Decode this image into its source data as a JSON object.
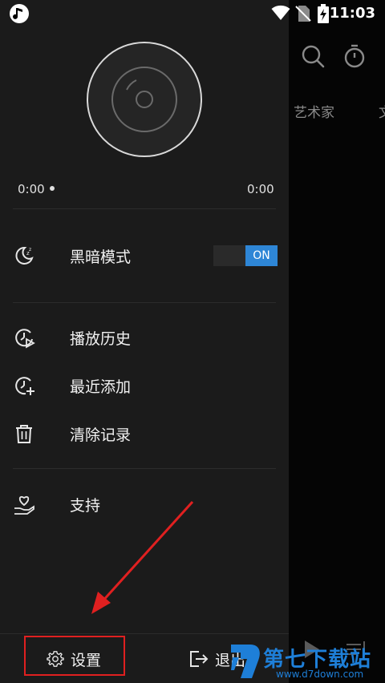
{
  "status_bar": {
    "time": "11:03"
  },
  "background": {
    "tabs": [
      {
        "label": "艺术家"
      },
      {
        "label": "文"
      }
    ]
  },
  "player": {
    "current_time": "0:00",
    "total_time": "0:00",
    "progress": 0
  },
  "menu": {
    "dark_mode": {
      "label": "黑暗模式",
      "toggle_label": "ON",
      "enabled": true
    },
    "history": {
      "label": "播放历史"
    },
    "recently_added": {
      "label": "最近添加"
    },
    "clear_records": {
      "label": "清除记录"
    },
    "support": {
      "label": "支持"
    }
  },
  "bottom": {
    "settings_label": "设置",
    "exit_label": "退出"
  },
  "colors": {
    "drawer_bg": "#1b1b1b",
    "toggle_on": "#2e86d6",
    "highlight": "#e02020",
    "watermark": "#1e7fd8"
  },
  "watermark": {
    "title": "第七下载站",
    "url": "www.d7down.com"
  }
}
